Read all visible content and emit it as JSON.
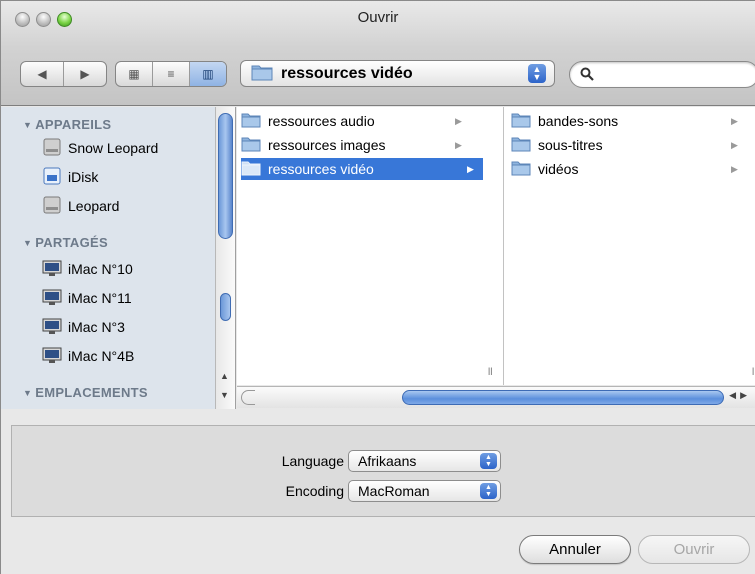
{
  "window": {
    "title": "Ouvrir"
  },
  "toolbar": {
    "back_icon": "back-arrow-icon",
    "forward_icon": "forward-arrow-icon",
    "view_icon_label": "▦",
    "view_list_label": "≡",
    "view_column_label": "▥",
    "location": "ressources vidéo",
    "search_placeholder": ""
  },
  "sidebar": {
    "sections": [
      {
        "label": "APPAREILS",
        "items": [
          {
            "label": "Snow Leopard",
            "icon": "hard-drive-icon"
          },
          {
            "label": "iDisk",
            "icon": "idisk-icon"
          },
          {
            "label": "Leopard",
            "icon": "hard-drive-icon"
          }
        ]
      },
      {
        "label": "PARTAGÉS",
        "items": [
          {
            "label": "iMac N°10",
            "icon": "network-computer-icon"
          },
          {
            "label": "iMac N°11",
            "icon": "network-computer-icon"
          },
          {
            "label": "iMac N°3",
            "icon": "network-computer-icon"
          },
          {
            "label": "iMac N°4B",
            "icon": "network-computer-icon"
          }
        ]
      },
      {
        "label": "EMPLACEMENTS",
        "items": []
      }
    ]
  },
  "browser": {
    "column1": [
      {
        "label": "ressources audio",
        "selected": false
      },
      {
        "label": "ressources images",
        "selected": false
      },
      {
        "label": "ressources vidéo",
        "selected": true
      }
    ],
    "column2": [
      {
        "label": "bandes-sons"
      },
      {
        "label": "sous-titres"
      },
      {
        "label": "vidéos"
      }
    ]
  },
  "accessory": {
    "language_label": "Language",
    "language_value": "Afrikaans",
    "encoding_label": "Encoding",
    "encoding_value": "MacRoman"
  },
  "buttons": {
    "cancel": "Annuler",
    "open": "Ouvrir"
  },
  "colors": {
    "selection": "#3877d8",
    "sidebar_bg": "#dde4ec",
    "sidebar_header": "#6d7a8a"
  }
}
